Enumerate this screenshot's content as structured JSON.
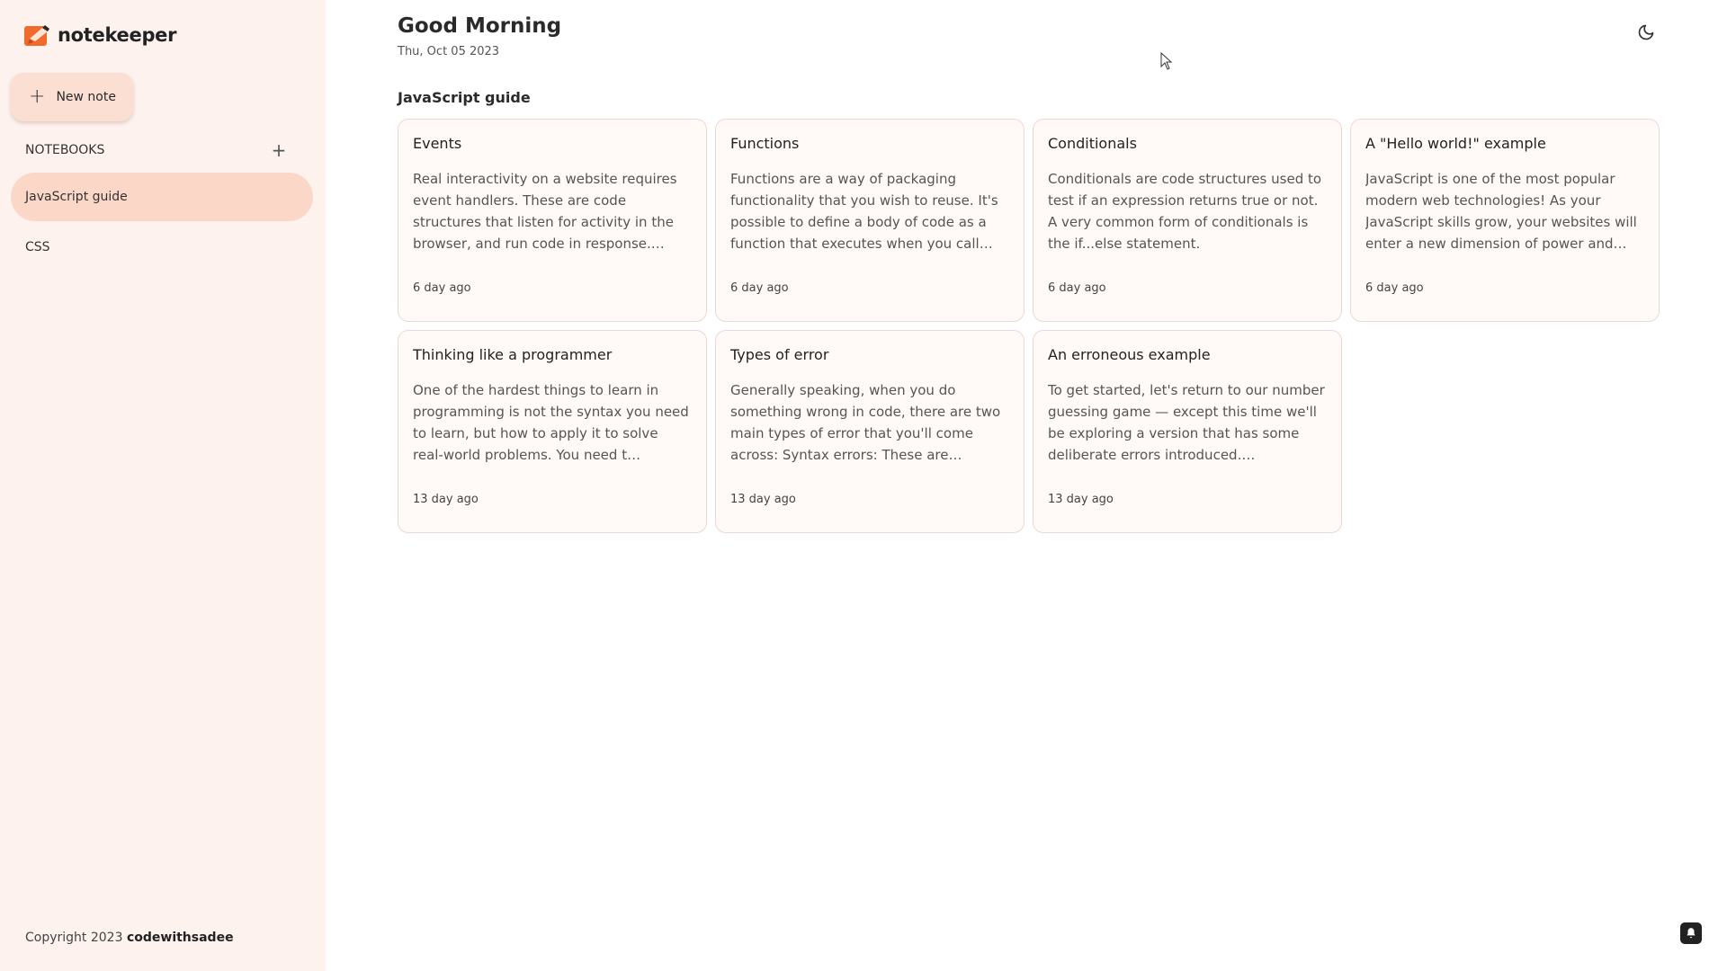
{
  "app": {
    "name": "notekeeper"
  },
  "sidebar": {
    "new_note_label": "New note",
    "notebooks_header": "NOTEBOOKS",
    "add_label": "+",
    "notebooks": [
      {
        "label": "JavaScript guide",
        "active": true
      },
      {
        "label": "CSS",
        "active": false
      }
    ],
    "copyright_prefix": "Copyright 2023",
    "copyright_author": "codewithsadee"
  },
  "header": {
    "greeting": "Good Morning",
    "date": "Thu, Oct 05 2023",
    "theme_toggle_icon": "moon-icon"
  },
  "main": {
    "notebook_title": "JavaScript guide",
    "notes": [
      {
        "title": "Events",
        "text": "Real interactivity on a website requires event handlers. These are code structures that listen for activity in the browser, and run code in response. The…",
        "time": "6 day ago"
      },
      {
        "title": "Functions",
        "text": "Functions are a way of packaging functionality that you wish to reuse. It's possible to define a body of code as a function that executes when you call…",
        "time": "6 day ago"
      },
      {
        "title": "Conditionals",
        "text": "Conditionals are code structures used to test if an expression returns true or not. A very common form of conditionals is the if...else statement.",
        "time": "6 day ago"
      },
      {
        "title": "A \"Hello world!\" example",
        "text": "JavaScript is one of the most popular modern web technologies! As your JavaScript skills grow, your websites will enter a new dimension of power and…",
        "time": "6 day ago"
      },
      {
        "title": "Thinking like a programmer",
        "text": "One of the hardest things to learn in programming is not the syntax you need to learn, but how to apply it to solve real-world problems. You need t…",
        "time": "13 day ago"
      },
      {
        "title": "Types of error",
        "text": "Generally speaking, when you do something wrong in code, there are two main types of error that you'll come across: Syntax errors: These are spellin…",
        "time": "13 day ago"
      },
      {
        "title": "An erroneous example",
        "text": "To get started, let's return to our number guessing game — except this time we'll be exploring a version that has some deliberate errors introduced.…",
        "time": "13 day ago"
      }
    ]
  },
  "colors": {
    "sidebar_bg": "#fdf2ee",
    "accent": "#f06a2c",
    "active_item": "#fbd7c8",
    "card_bg": "#fffaf7",
    "card_border": "#ead9d2"
  }
}
